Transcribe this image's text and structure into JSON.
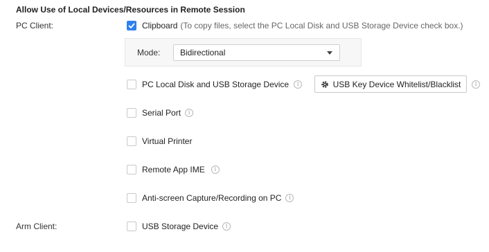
{
  "section": {
    "title": "Allow Use of Local Devices/Resources in Remote Session"
  },
  "pc_client": {
    "label": "PC Client:",
    "clipboard": {
      "label": "Clipboard",
      "hint": "(To copy files, select the PC Local Disk and USB Storage Device check box.)",
      "checked": true
    },
    "mode": {
      "label": "Mode:",
      "value": "Bidirectional"
    },
    "local_disk": {
      "label": "PC Local Disk and USB Storage Device",
      "checked": false
    },
    "usb_whitelist_button": {
      "label": "USB Key Device Whitelist/Blacklist"
    },
    "serial_port": {
      "label": "Serial Port",
      "checked": false
    },
    "virtual_printer": {
      "label": "Virtual Printer",
      "checked": false
    },
    "remote_app_ime": {
      "label": "Remote App IME",
      "checked": false
    },
    "anti_capture": {
      "label": "Anti-screen Capture/Recording on PC",
      "checked": false
    }
  },
  "arm_client": {
    "label": "Arm Client:",
    "usb_storage": {
      "label": "USB Storage Device",
      "checked": false
    }
  },
  "colors": {
    "accent": "#2f80ed",
    "border": "#c9c9c9",
    "panel_bg": "#f7f7f7"
  },
  "icons": {
    "info": "info-circle-icon",
    "gear": "gear-icon",
    "check": "checkmark-icon",
    "dropdown": "caret-down-icon"
  }
}
